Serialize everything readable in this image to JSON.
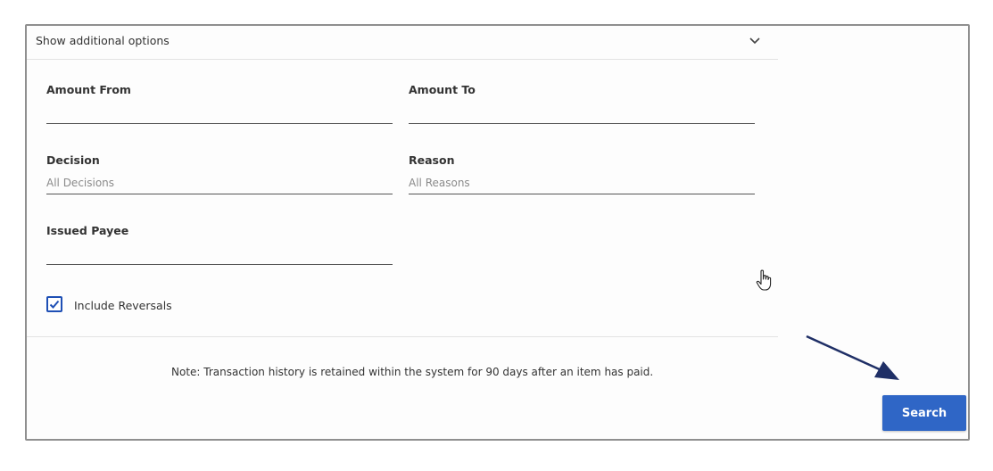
{
  "accordion": {
    "title": "Show additional options",
    "icon": "chevron-down-icon"
  },
  "fields": {
    "amount_from": {
      "label": "Amount From",
      "value": ""
    },
    "amount_to": {
      "label": "Amount To",
      "value": ""
    },
    "decision": {
      "label": "Decision",
      "placeholder": "All Decisions"
    },
    "reason": {
      "label": "Reason",
      "placeholder": "All Reasons"
    },
    "issued_payee": {
      "label": "Issued Payee",
      "value": ""
    }
  },
  "include_reversals": {
    "label": "Include Reversals",
    "checked": true,
    "icon": "checkmark-icon"
  },
  "note": "Note: Transaction history is retained within the system for 90 days after an item has paid.",
  "search_button": {
    "label": "Search"
  },
  "colors": {
    "accent": "#2f66c6",
    "checkbox": "#1e4fb5",
    "arrow": "#1f2f66"
  }
}
